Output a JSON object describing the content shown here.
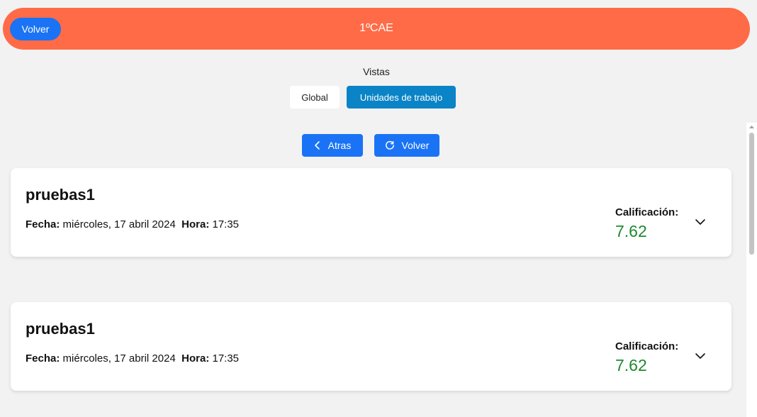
{
  "header": {
    "back_label": "Volver",
    "title": "1ºCAE"
  },
  "views": {
    "label": "Vistas",
    "options": [
      "Global",
      "Unidades de trabajo"
    ],
    "selected": "Unidades de trabajo"
  },
  "nav": {
    "back_label": "Atras",
    "reload_label": "Volver"
  },
  "cards": [
    {
      "name": "pruebas1",
      "date_label": "Fecha:",
      "date": "miércoles, 17 abril 2024",
      "time_label": "Hora:",
      "time": "17:35",
      "grade_label": "Calificación:",
      "grade": "7.62"
    },
    {
      "name": "pruebas1",
      "date_label": "Fecha:",
      "date": "miércoles, 17 abril 2024",
      "time_label": "Hora:",
      "time": "17:35",
      "grade_label": "Calificación:",
      "grade": "7.62"
    }
  ],
  "colors": {
    "header_bg": "#ff6b47",
    "primary": "#1a73f5",
    "selected_view": "#0a84c6",
    "grade": "#1e8a2e"
  }
}
